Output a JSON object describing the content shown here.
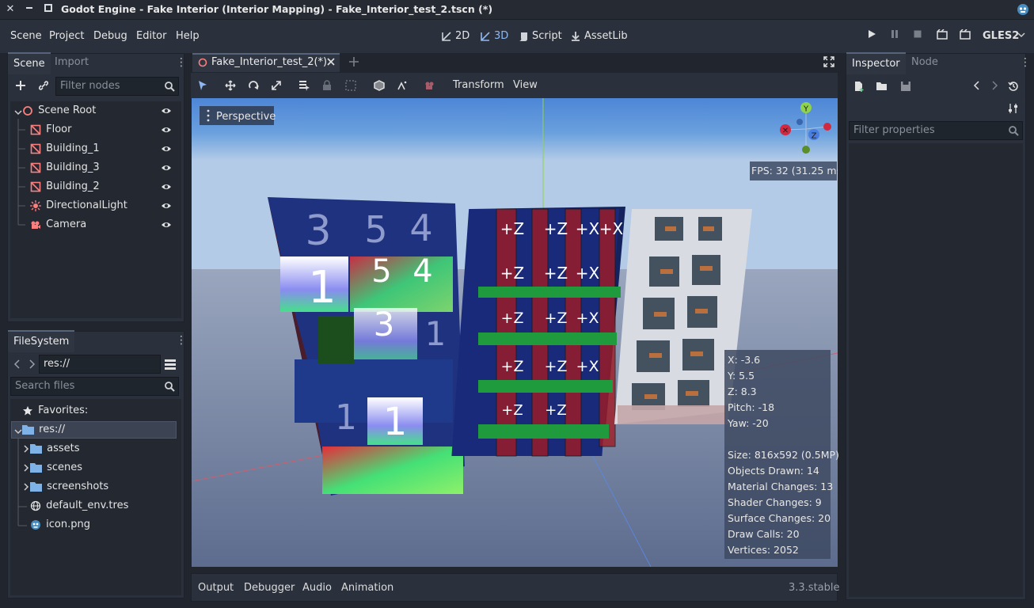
{
  "window": {
    "title": "Godot Engine - Fake Interior (Interior Mapping) - Fake_Interior_test_2.tscn (*)"
  },
  "menu": [
    "Scene",
    "Project",
    "Debug",
    "Editor",
    "Help"
  ],
  "workspaces": [
    {
      "label": "2D",
      "active": false
    },
    {
      "label": "3D",
      "active": true
    },
    {
      "label": "Script",
      "active": false
    },
    {
      "label": "AssetLib",
      "active": false
    }
  ],
  "renderer": "GLES2",
  "scene_dock": {
    "tabs": [
      "Scene",
      "Import"
    ],
    "filter_placeholder": "Filter nodes",
    "tree": [
      {
        "label": "Scene Root",
        "icon": "scene-root-icon"
      },
      {
        "label": "Floor",
        "icon": "mesh-instance-icon"
      },
      {
        "label": "Building_1",
        "icon": "mesh-instance-icon"
      },
      {
        "label": "Building_3",
        "icon": "mesh-instance-icon"
      },
      {
        "label": "Building_2",
        "icon": "mesh-instance-icon"
      },
      {
        "label": "DirectionalLight",
        "icon": "light-icon"
      },
      {
        "label": "Camera",
        "icon": "camera-icon"
      }
    ]
  },
  "filesystem": {
    "tab": "FileSystem",
    "path": "res://",
    "search_placeholder": "Search files",
    "favorites": "Favorites:",
    "items": [
      {
        "label": "res://",
        "type": "folder",
        "expanded": true
      },
      {
        "label": "assets",
        "type": "folder"
      },
      {
        "label": "scenes",
        "type": "folder"
      },
      {
        "label": "screenshots",
        "type": "folder"
      },
      {
        "label": "default_env.tres",
        "type": "environment"
      },
      {
        "label": "icon.png",
        "type": "image"
      }
    ]
  },
  "editor": {
    "scene_tab": "Fake_Interior_test_2(*)",
    "toolbar": {
      "transform": "Transform",
      "view": "View"
    },
    "viewport_label": "Perspective",
    "fps": "FPS: 32 (31.25 ms)",
    "gizmo": {
      "y": "Y",
      "z": "Z"
    },
    "cube_labels": {
      "plus_z": "+Z",
      "plus_x": "+X"
    },
    "numbers": {
      "three": "3",
      "four": "4",
      "five": "5",
      "one": "1"
    },
    "stats": [
      "X: -3.6",
      "Y: 5.5",
      "Z: 8.3",
      "Pitch: -18",
      "Yaw: -20",
      "",
      "Size: 816x592 (0.5MP)",
      "Objects Drawn: 14",
      "Material Changes: 13",
      "Shader Changes: 9",
      "Surface Changes: 20",
      "Draw Calls: 20",
      "Vertices: 2052"
    ]
  },
  "bottom_panel": {
    "tabs": [
      "Output",
      "Debugger",
      "Audio",
      "Animation"
    ],
    "version": "3.3.stable"
  },
  "inspector": {
    "tabs": [
      "Inspector",
      "Node"
    ],
    "filter_placeholder": "Filter properties"
  },
  "colors": {
    "accent": "#8fb8f0",
    "bg": "#20252e",
    "panel": "#2a313c"
  }
}
